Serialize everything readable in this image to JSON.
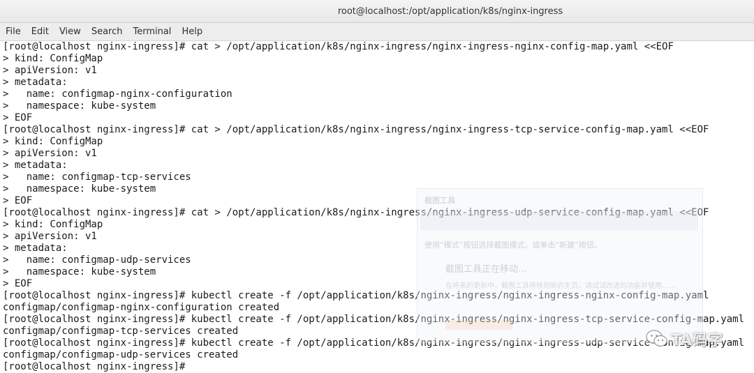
{
  "window": {
    "title": "root@localhost:/opt/application/k8s/nginx-ingress"
  },
  "menubar": {
    "items": [
      "File",
      "Edit",
      "View",
      "Search",
      "Terminal",
      "Help"
    ]
  },
  "terminal": {
    "lines": [
      "[root@localhost nginx-ingress]# cat > /opt/application/k8s/nginx-ingress/nginx-ingress-nginx-config-map.yaml <<EOF",
      "> kind: ConfigMap",
      "> apiVersion: v1",
      "> metadata:",
      ">   name: configmap-nginx-configuration",
      ">   namespace: kube-system",
      "> EOF",
      "[root@localhost nginx-ingress]# cat > /opt/application/k8s/nginx-ingress/nginx-ingress-tcp-service-config-map.yaml <<EOF",
      "> kind: ConfigMap",
      "> apiVersion: v1",
      "> metadata:",
      ">   name: configmap-tcp-services",
      ">   namespace: kube-system",
      "> EOF",
      "[root@localhost nginx-ingress]# cat > /opt/application/k8s/nginx-ingress/nginx-ingress-udp-service-config-map.yaml <<EOF",
      "> kind: ConfigMap",
      "> apiVersion: v1",
      "> metadata:",
      ">   name: configmap-udp-services",
      ">   namespace: kube-system",
      "> EOF",
      "[root@localhost nginx-ingress]# kubectl create -f /opt/application/k8s/nginx-ingress/nginx-ingress-nginx-config-map.yaml",
      "configmap/configmap-nginx-configuration created",
      "[root@localhost nginx-ingress]# kubectl create -f /opt/application/k8s/nginx-ingress/nginx-ingress-tcp-service-config-map.yaml",
      "configmap/configmap-tcp-services created",
      "[root@localhost nginx-ingress]# kubectl create -f /opt/application/k8s/nginx-ingress/nginx-ingress-udp-service-config-map.yaml",
      "configmap/configmap-udp-services created",
      "[root@localhost nginx-ingress]# "
    ]
  },
  "overlay": {
    "title": "截图工具",
    "hint": "使用“模式”按钮选择截图模式，或单击“新建”按钮。",
    "notice": "截图工具正在移动...",
    "detail": "在将来的更新中，截图工具将移到新的主页。请试试改进的功能并使用……"
  },
  "watermark": {
    "text": "TA码字"
  }
}
